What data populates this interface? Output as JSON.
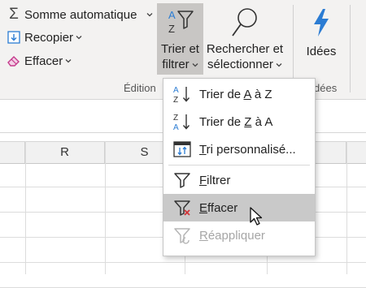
{
  "ribbon": {
    "editing_group": {
      "label": "Édition",
      "autosum_label": "Somme automatique",
      "fill_label": "Recopier",
      "clear_label": "Effacer"
    },
    "sort_filter": {
      "line1": "Trier et",
      "line2": "filtrer"
    },
    "find_select": {
      "line1": "Rechercher et",
      "line2": "sélectionner"
    },
    "ideas": {
      "label": "Idées",
      "group_label_partial": "dées"
    }
  },
  "sheet": {
    "columns": [
      "R",
      "S"
    ]
  },
  "menu": {
    "items": [
      {
        "pre": "Trier de ",
        "key": "A",
        "post": " à Z",
        "icon": "sort-az-icon",
        "state": "normal"
      },
      {
        "pre": "Trier de ",
        "key": "Z",
        "post": " à A",
        "icon": "sort-za-icon",
        "state": "normal"
      },
      {
        "pre": "",
        "key": "T",
        "post": "ri personnalisé...",
        "icon": "custom-sort-icon",
        "state": "normal"
      },
      {
        "pre": "",
        "key": "F",
        "post": "iltrer",
        "icon": "filter-icon",
        "state": "normal"
      },
      {
        "pre": "",
        "key": "E",
        "post": "ffacer",
        "icon": "clear-filter-icon",
        "state": "hover"
      },
      {
        "pre": "",
        "key": "R",
        "post": "éappliquer",
        "icon": "reapply-icon",
        "state": "disabled"
      }
    ]
  },
  "colors": {
    "ribbon_bg": "#f3f2f1",
    "accent_blue": "#2b7cd3",
    "eraser_pink": "#c53a8c",
    "clear_red": "#d13438",
    "hover_bg": "#c9c9c9"
  }
}
